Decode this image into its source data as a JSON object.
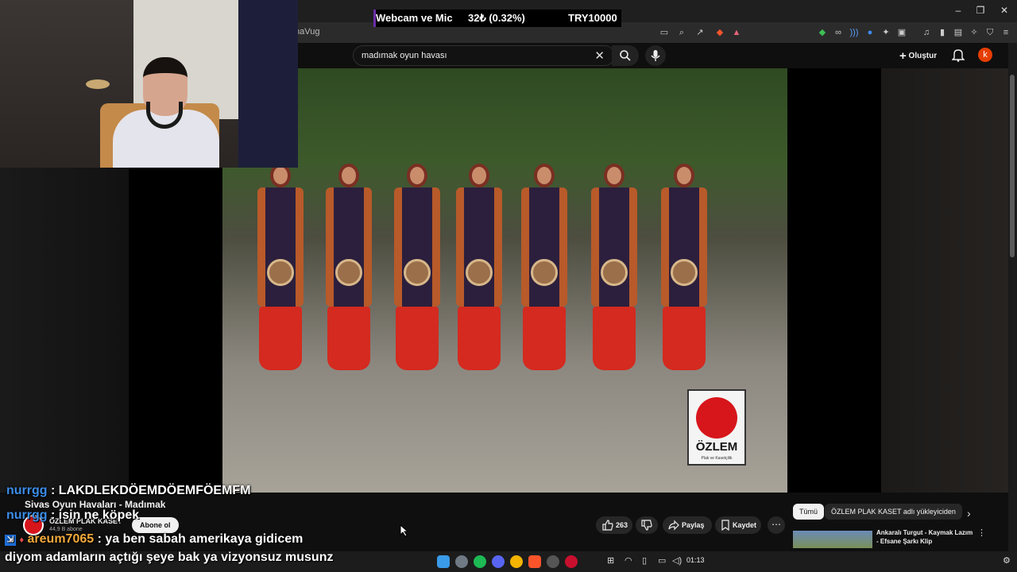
{
  "stream_overlay": {
    "label": "Webcam ve Mic",
    "amount": "32₺ (0.32%)",
    "goal": "TRY10000"
  },
  "browser": {
    "address": "maVug"
  },
  "youtube": {
    "search_query": "madımak oyun havası",
    "create_label": "Oluştur",
    "avatar_letter": "k"
  },
  "video": {
    "logo_text": "ÖZLEM",
    "logo_sub": "Plak ve Kasetçilik",
    "title": "Sivas Oyun Havaları - Madımak",
    "channel": "ÖZLEM PLAK KASET",
    "subscribers": "44,9 B abone",
    "subscribe_label": "Abone ol",
    "likes": "263",
    "share_label": "Paylaş",
    "save_label": "Kaydet"
  },
  "recommendations": {
    "chips": [
      "Tümü",
      "ÖZLEM PLAK KASET adlı yükleyiciden"
    ],
    "items": [
      {
        "title": "Ankaralı Turgut - Kaymak Lazım - Efsane Şarkı Klip"
      }
    ]
  },
  "chat": [
    {
      "user": "nurrgg",
      "message": ": LAKDLEKDÖEMDÖEMFÖEMFM"
    },
    {
      "user": "nurrgg",
      "message": ": isin ne köpek"
    },
    {
      "user": "areum7065",
      "message": ": ya ben sabah amerikaya gidicem"
    }
  ],
  "caption": "diyom adamların açtığı şeye bak ya vizyonsuz musunz",
  "taskbar": {
    "time": "01:13"
  },
  "colors": {
    "accent": "#3ea6ff",
    "brand_red": "#d7161c",
    "chat_user": "#3b8de8",
    "chat_user_gift": "#f2a93b"
  }
}
